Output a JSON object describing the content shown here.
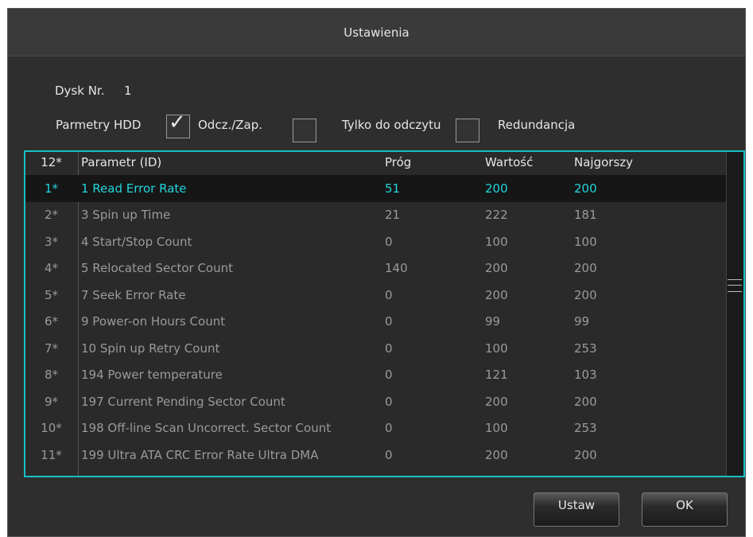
{
  "dialog": {
    "title": "Ustawienia"
  },
  "disk": {
    "label": "Dysk Nr.",
    "number": "1"
  },
  "hdd_params": {
    "label": "Parmetry HDD",
    "options": [
      {
        "label": "Odcz./Zap.",
        "checked": true
      },
      {
        "label": "Tylko do odczytu",
        "checked": false
      },
      {
        "label": "Redundancja",
        "checked": false
      }
    ]
  },
  "table": {
    "headers": {
      "num": "12*",
      "name": "Parametr (ID)",
      "prog": "Próg",
      "value": "Wartość",
      "worst": "Najgorszy"
    },
    "rows": [
      {
        "num": "1*",
        "name": "1 Read Error Rate",
        "prog": "51",
        "value": "200",
        "worst": "200",
        "selected": true
      },
      {
        "num": "2*",
        "name": "3 Spin up Time",
        "prog": "21",
        "value": "222",
        "worst": "181"
      },
      {
        "num": "3*",
        "name": "4 Start/Stop Count",
        "prog": "0",
        "value": "100",
        "worst": "100"
      },
      {
        "num": "4*",
        "name": "5 Relocated Sector Count",
        "prog": "140",
        "value": "200",
        "worst": "200"
      },
      {
        "num": "5*",
        "name": "7 Seek Error Rate",
        "prog": "0",
        "value": "200",
        "worst": "200"
      },
      {
        "num": "6*",
        "name": "9 Power-on Hours Count",
        "prog": "0",
        "value": "99",
        "worst": "99"
      },
      {
        "num": "7*",
        "name": "10 Spin up Retry Count",
        "prog": "0",
        "value": "100",
        "worst": "253"
      },
      {
        "num": "8*",
        "name": "194 Power temperature",
        "prog": "0",
        "value": "121",
        "worst": "103"
      },
      {
        "num": "9*",
        "name": "197 Current Pending Sector Count",
        "prog": "0",
        "value": "200",
        "worst": "200"
      },
      {
        "num": "10*",
        "name": "198 Off-line Scan Uncorrect. Sector Count",
        "prog": "0",
        "value": "100",
        "worst": "253"
      },
      {
        "num": "11*",
        "name": "199 Ultra ATA CRC Error Rate Ultra DMA",
        "prog": "0",
        "value": "200",
        "worst": "200"
      }
    ]
  },
  "buttons": {
    "set": "Ustaw",
    "ok": "OK"
  },
  "colors": {
    "accent": "#17c0c6",
    "selected_text": "#22d4dc",
    "background": "#2e2e2e"
  }
}
